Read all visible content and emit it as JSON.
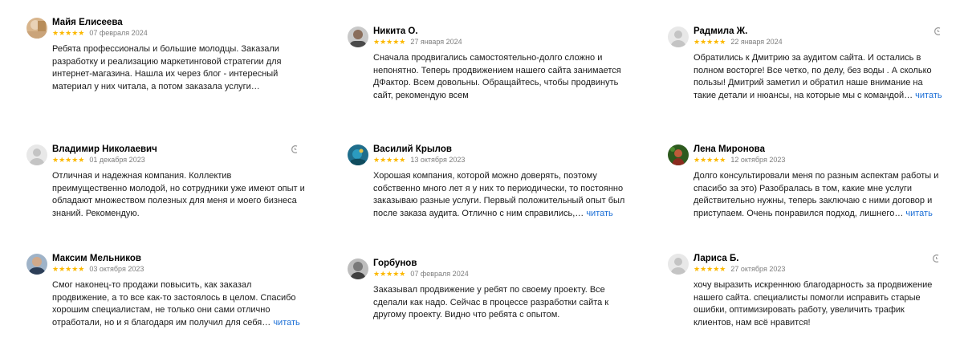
{
  "more_label": "читать",
  "reviews": [
    {
      "name": "Майя Елисеева",
      "stars": "★★★★★",
      "date": "07 февраля 2024",
      "text": "Ребята профессионалы и большие молодцы. Заказали разработку и реализацию маркетинговой стратегии для интернет-магазина. Нашла их через блог - интересный материал у них читала, а потом заказала услуги…",
      "avatar": "photo-avatar"
    },
    {
      "name": "Никита О.",
      "stars": "★★★★★",
      "date": "27 января 2024",
      "text": "Сначала продвигались самостоятельно-долго сложно и непонятно. Теперь продвижением нашего сайта занимается ДФактор. Всем довольны. Обращайтесь, чтобы продвинуть сайт, рекомендую всем",
      "avatar": "photo-avatar"
    },
    {
      "name": "Радмила Ж.",
      "stars": "★★★★★",
      "date": "22 января 2024",
      "text": "Обратились к Дмитрию за аудитом сайта. И остались в полном восторге! Все четко, по делу, без воды . А сколько пользы! Дмитрий заметил и обратил наше внимание на такие детали и нюансы, на которые мы с командой…",
      "avatar": "default-avatar"
    },
    {
      "name": "Владимир Николаевич",
      "stars": "★★★★★",
      "date": "01 декабря 2023",
      "text": "Отличная и надежная компания. Коллектив преимущественно молодой, но сотрудники уже имеют опыт и обладают множеством полезных для меня и моего бизнеса знаний. Рекомендую.",
      "avatar": "default-avatar"
    },
    {
      "name": "Василий Крылов",
      "stars": "★★★★★",
      "date": "13 октября 2023",
      "text": "Хорошая компания, которой можно доверять, поэтому собственно много лет я у них то периодически, то постоянно заказываю разные услуги. Первый положительный опыт был после заказа аудита. Отлично с ним справились,…",
      "avatar": "photo-avatar"
    },
    {
      "name": "Лена Миронова",
      "stars": "★★★★★",
      "date": "12 октября 2023",
      "text": "Долго консультировали меня по разным аспектам работы и спасибо за это) Разобралась в том, какие мне услуги действительно нужны, теперь заключаю с ними договор и приступаем. Очень понравился подход, лишнего…",
      "avatar": "photo-avatar"
    },
    {
      "name": "Максим Мельников",
      "stars": "★★★★★",
      "date": "03 октября 2023",
      "text": "Смог наконец-то продажи повысить, как заказал продвижение, а то все как-то застоялось в целом. Спасибо хорошим специалистам, не только они сами отлично отработали, но и я благодаря им получил для себя…",
      "avatar": "photo-avatar"
    },
    {
      "name": "Горбунов",
      "stars": "★★★★★",
      "date": "07 февраля 2024",
      "text": "Заказывал продвижение у ребят по своему проекту. Все сделали как надо. Сейчас в процессе разработки сайта к другому проекту. Видно что ребята с опытом.",
      "avatar": "photo-avatar"
    },
    {
      "name": "Лариса Б.",
      "stars": "★★★★★",
      "date": "27 октября 2023",
      "text": "хочу выразить искреннюю благодарность за продвижение нашего сайта. специалисты помогли исправить старые ошибки, оптимизировать работу, увеличить трафик клиентов, нам всё нравится!",
      "avatar": "default-avatar"
    }
  ]
}
